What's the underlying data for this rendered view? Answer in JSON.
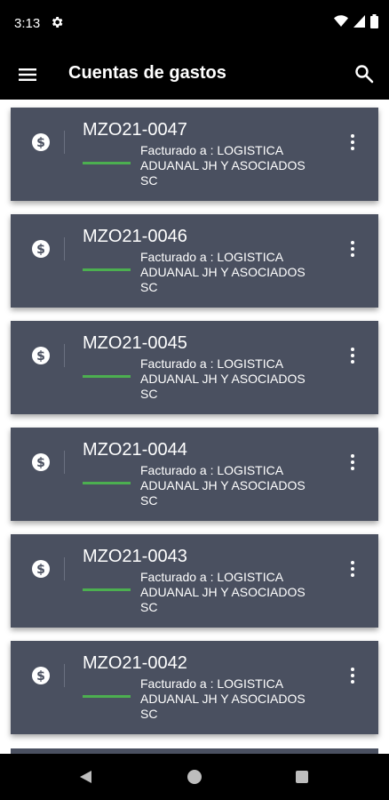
{
  "status": {
    "time": "3:13"
  },
  "app": {
    "title": "Cuentas de gastos"
  },
  "cards": [
    {
      "code": "MZO21-0047",
      "label": "Facturado a : LOGISTICA ADUANAL JH Y ASOCIADOS SC"
    },
    {
      "code": "MZO21-0046",
      "label": "Facturado a : LOGISTICA ADUANAL JH Y ASOCIADOS SC"
    },
    {
      "code": "MZO21-0045",
      "label": "Facturado a : LOGISTICA ADUANAL JH Y ASOCIADOS SC"
    },
    {
      "code": "MZO21-0044",
      "label": "Facturado a : LOGISTICA ADUANAL JH Y ASOCIADOS SC"
    },
    {
      "code": "MZO21-0043",
      "label": "Facturado a : LOGISTICA ADUANAL JH Y ASOCIADOS SC"
    },
    {
      "code": "MZO21-0042",
      "label": "Facturado a : LOGISTICA ADUANAL JH Y ASOCIADOS SC"
    }
  ],
  "colors": {
    "card_bg": "#4a5060",
    "status_bar": "#4caf50",
    "app_bar": "#000000"
  },
  "icons": {
    "menu": "menu-icon",
    "search": "search-icon",
    "card": "dollar-icon",
    "card_action": "more-vert-icon"
  }
}
